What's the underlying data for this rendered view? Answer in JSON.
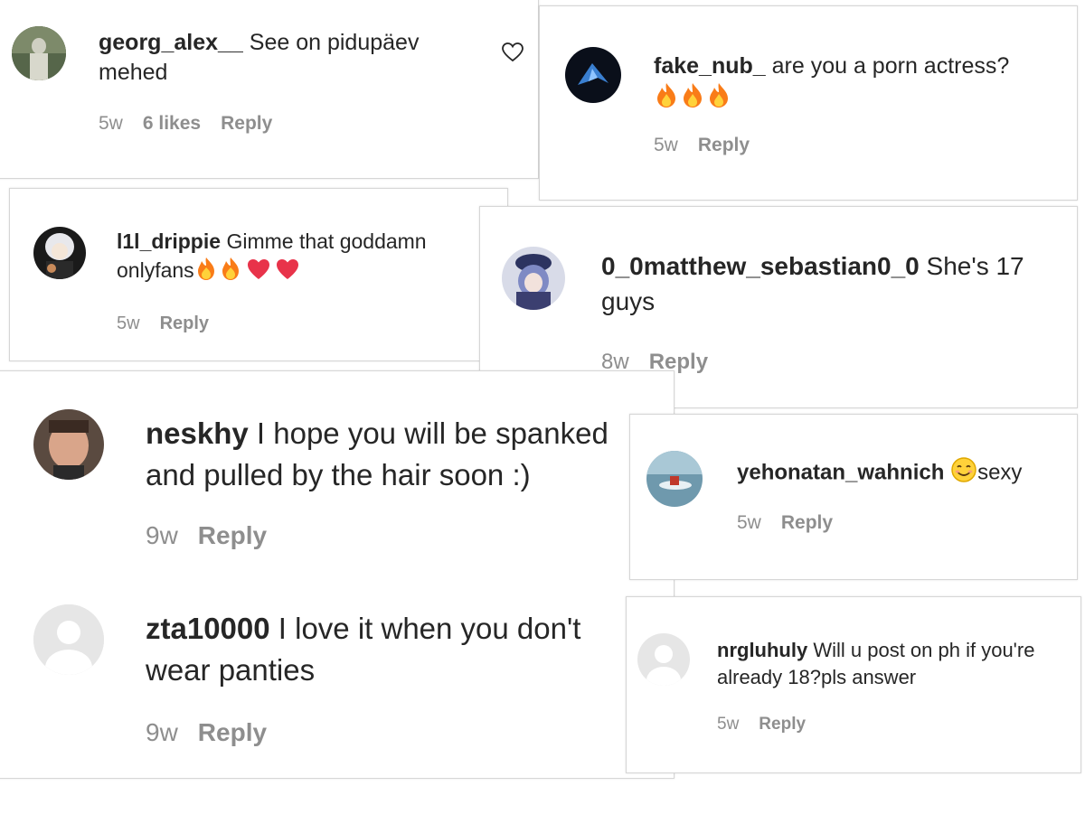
{
  "comments": [
    {
      "user": "georg_alex__",
      "text": "See on pidupäev mehed",
      "time": "5w",
      "likes": "6 likes",
      "reply": "Reply",
      "emojis": []
    },
    {
      "user": "fake_nub_",
      "text": "are you a porn actress?",
      "time": "5w",
      "reply": "Reply",
      "emojis": [
        "fire",
        "fire",
        "fire"
      ]
    },
    {
      "user": "l1l_drippie",
      "text": "Gimme that goddamn onlyfans",
      "time": "5w",
      "reply": "Reply",
      "emojis": [
        "fire",
        "fire",
        "heart",
        "heart"
      ]
    },
    {
      "user": "0_0matthew_sebastian0_0",
      "text": "She's 17 guys",
      "time": "8w",
      "reply": "Reply",
      "emojis": []
    },
    {
      "user": "neskhy",
      "text": "I hope you will be spanked and pulled by the hair soon :)",
      "time": "9w",
      "reply": "Reply",
      "emojis": []
    },
    {
      "user": "yehonatan_wahnich",
      "text": "sexy",
      "time": "5w",
      "reply": "Reply",
      "emojis": [
        "smiling-face"
      ]
    },
    {
      "user": "zta10000",
      "text": "I love it when you don't wear panties",
      "time": "9w",
      "reply": "Reply",
      "emojis": []
    },
    {
      "user": "nrgluhuly",
      "text": "Will u post on ph if you're already 18?pls answer",
      "time": "5w",
      "reply": "Reply",
      "emojis": []
    }
  ],
  "icons": {
    "like": "heart-outline-icon",
    "fire": "fire-emoji-icon",
    "heart": "red-heart-emoji-icon",
    "smile": "smiling-face-emoji-icon",
    "avatar_placeholder": "default-avatar-icon"
  },
  "colors": {
    "meta": "#8e8e8e",
    "text": "#262626",
    "heart": "#e8334a",
    "fire": "#f97c18"
  }
}
